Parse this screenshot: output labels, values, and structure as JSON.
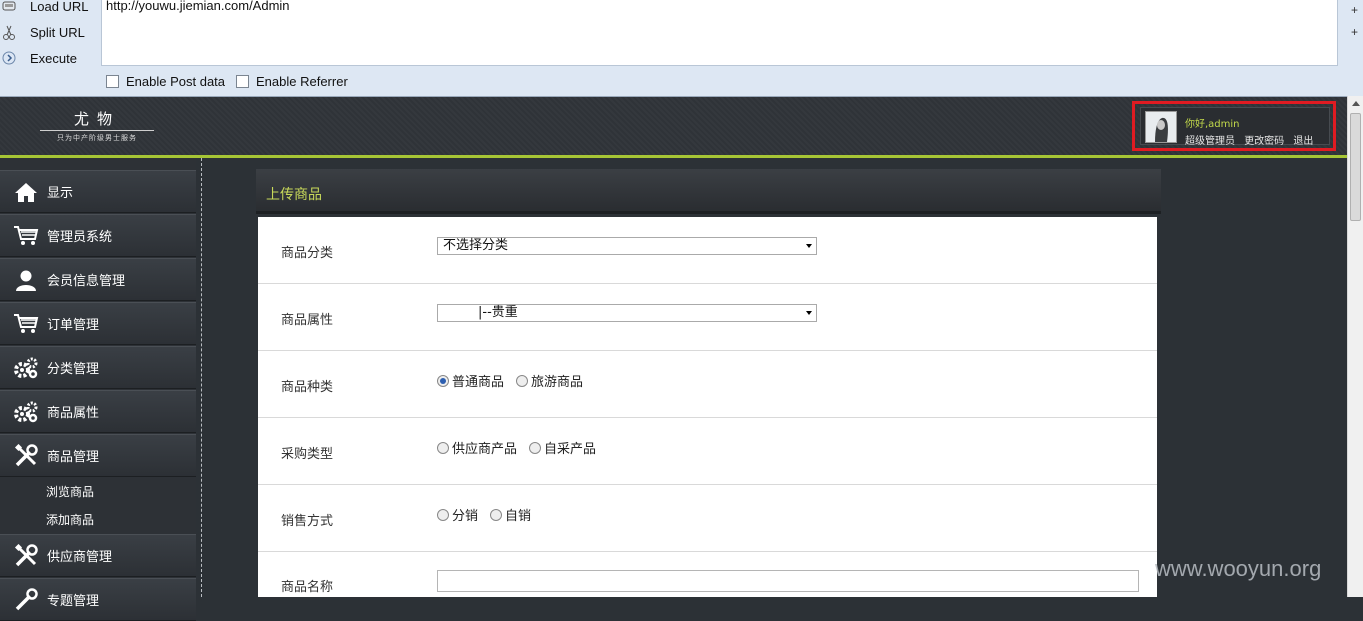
{
  "hackbar": {
    "load_url": "Load URL",
    "split_url": "Split URL",
    "execute": "Execute",
    "url_value": "http://youwu.jiemian.com/Admin",
    "enable_post": "Enable Post data",
    "enable_referrer": "Enable Referrer",
    "plus": "+"
  },
  "header": {
    "logo_title": "尤物",
    "logo_slogan": "只为中产阶级男士服务",
    "greeting": "你好,admin",
    "role": "超级管理员",
    "change_password": "更改密码",
    "logout": "退出",
    "highlight_color": "#e01b22"
  },
  "sidebar": {
    "items": [
      {
        "label": "显示",
        "icon": "home-icon"
      },
      {
        "label": "管理员系统",
        "icon": "cart-icon"
      },
      {
        "label": "会员信息管理",
        "icon": "user-icon"
      },
      {
        "label": "订单管理",
        "icon": "cart-icon"
      },
      {
        "label": "分类管理",
        "icon": "gears-icon"
      },
      {
        "label": "商品属性",
        "icon": "gears-icon"
      },
      {
        "label": "商品管理",
        "icon": "tools-icon"
      },
      {
        "label": "供应商管理",
        "icon": "tools-icon"
      },
      {
        "label": "专题管理",
        "icon": "tools-icon"
      }
    ],
    "subitems": [
      "浏览商品",
      "添加商品"
    ]
  },
  "panel": {
    "title": "上传商品",
    "title_color": "#c8d95a"
  },
  "form": {
    "category_label": "商品分类",
    "category_value": "不选择分类",
    "attribute_label": "商品属性",
    "attribute_value": "|--贵重",
    "type_label": "商品种类",
    "type_options": [
      "普通商品",
      "旅游商品"
    ],
    "type_selected": "普通商品",
    "purchase_label": "采购类型",
    "purchase_options": [
      "供应商产品",
      "自采产品"
    ],
    "sales_label": "销售方式",
    "sales_options": [
      "分销",
      "自销"
    ],
    "name_label": "商品名称",
    "name_value": ""
  },
  "watermark": "www.wooyun.org"
}
